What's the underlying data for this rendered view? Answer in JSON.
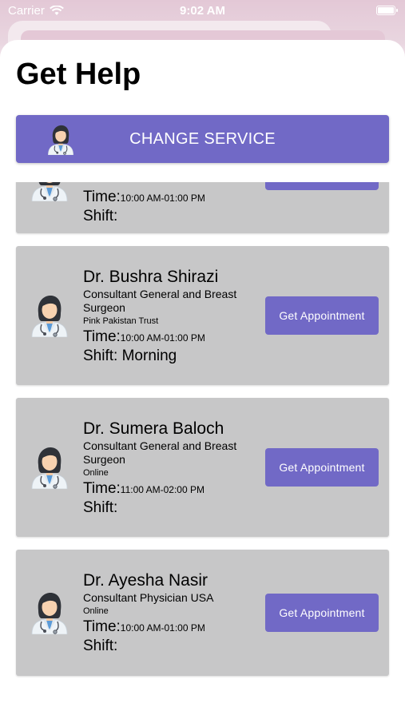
{
  "status_bar": {
    "carrier": "Carrier",
    "time": "9:02 AM"
  },
  "page": {
    "title": "Get Help"
  },
  "change_service": {
    "label": "CHANGE SERVICE"
  },
  "doctors": [
    {
      "name": "",
      "specialty": "",
      "org": "",
      "time_label": "Time:",
      "time_value": "10:00 AM-01:00 PM",
      "shift_label": "Shift:",
      "shift_value": "",
      "button_label": ""
    },
    {
      "name": "Dr. Bushra Shirazi",
      "specialty": "Consultant General and Breast Surgeon",
      "org": "Pink Pakistan Trust",
      "time_label": "Time:",
      "time_value": "10:00 AM-01:00 PM",
      "shift_label": "Shift:",
      "shift_value": "Morning",
      "button_label": "Get Appointment"
    },
    {
      "name": "Dr. Sumera Baloch",
      "specialty": "Consultant General and Breast Surgeon",
      "org": "Online",
      "time_label": "Time:",
      "time_value": "11:00 AM-02:00 PM",
      "shift_label": "Shift:",
      "shift_value": "",
      "button_label": "Get Appointment"
    },
    {
      "name": "Dr. Ayesha Nasir",
      "specialty": "Consultant Physician USA",
      "org": "Online",
      "time_label": "Time:",
      "time_value": "10:00 AM-01:00 PM",
      "shift_label": "Shift:",
      "shift_value": "",
      "button_label": "Get Appointment"
    }
  ],
  "icons": {
    "doctor_avatar": "female-doctor-icon",
    "wifi": "wifi-icon",
    "battery": "battery-icon"
  },
  "colors": {
    "accent": "#7169c6",
    "card_bg": "#c7c7c8"
  }
}
